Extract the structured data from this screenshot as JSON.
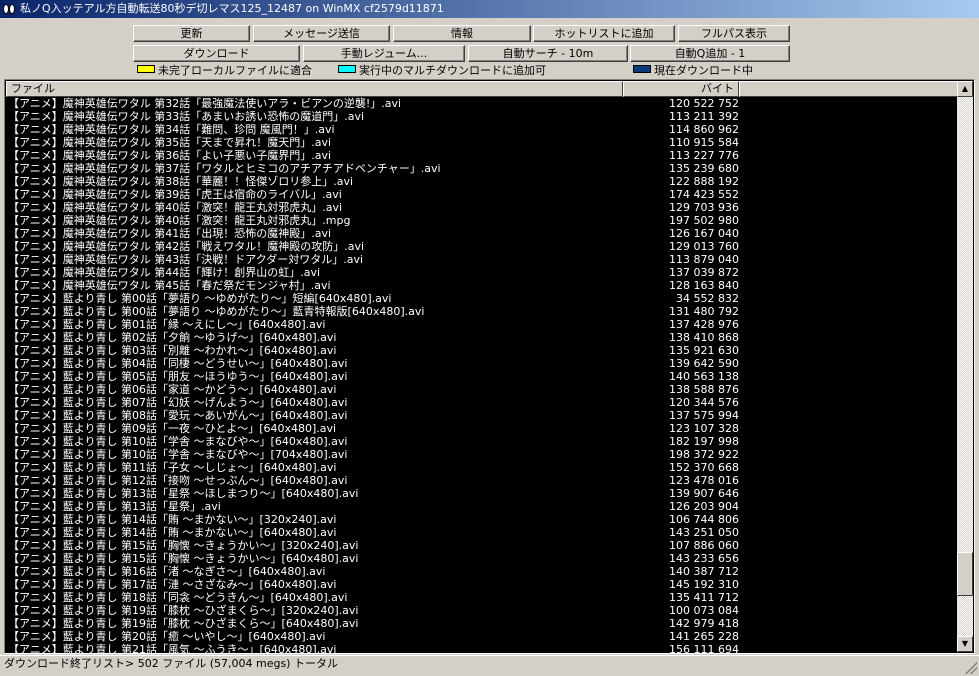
{
  "window": {
    "title": "私ノQ入ッテアル方自動転送80秒デ切レマス125_12487 on WinMX cf2579d11871"
  },
  "toolbar": {
    "row1": [
      "更新",
      "メッセージ送信",
      "情報",
      "ホットリストに追加",
      "フルパス表示"
    ],
    "row2": [
      "ダウンロード",
      "手動レジューム...",
      "自動サーチ - 10m",
      "自動Q追加 - 1"
    ]
  },
  "legend": [
    {
      "label": "未完了ローカルファイルに適合",
      "color": "#ffff00"
    },
    {
      "label": "実行中のマルチダウンロードに追加可",
      "color": "#00ffff"
    },
    {
      "label": "現在ダウンロード中",
      "color": "#0a3a7a"
    }
  ],
  "list": {
    "columns": [
      "ファイル",
      "バイト"
    ],
    "rows": [
      [
        "【アニメ】魔神英雄伝ワタル 第32話「最強魔法使いアラ・ビアンの逆襲!」.avi",
        "120 522 752"
      ],
      [
        "【アニメ】魔神英雄伝ワタル 第33話「あまいお誘い恐怖の魔道門」.avi",
        "113 211 392"
      ],
      [
        "【アニメ】魔神英雄伝ワタル 第34話「難問、珍問 魔風門！」.avi",
        "114 860 962"
      ],
      [
        "【アニメ】魔神英雄伝ワタル 第35話「天まで昇れ！魔天門」.avi",
        "110 915 584"
      ],
      [
        "【アニメ】魔神英雄伝ワタル 第36話「よい子悪い子魔界門」.avi",
        "113 227 776"
      ],
      [
        "【アニメ】魔神英雄伝ワタル 第37話「ワタルとヒミコのアチアチアドベンチャー」.avi",
        "135 239 680"
      ],
      [
        "【アニメ】魔神英雄伝ワタル 第38話「華麗！！怪傑ゾロリ参上」.avi",
        "122 888 192"
      ],
      [
        "【アニメ】魔神英雄伝ワタル 第39話「虎王は宿命のライバル」.avi",
        "174 423 552"
      ],
      [
        "【アニメ】魔神英雄伝ワタル 第40話「激突！龍王丸対邪虎丸」.avi",
        "129 703 936"
      ],
      [
        "【アニメ】魔神英雄伝ワタル 第40話「激突！龍王丸対邪虎丸」.mpg",
        "197 502 980"
      ],
      [
        "【アニメ】魔神英雄伝ワタル 第41話「出現！恐怖の魔神殿」.avi",
        "126 167 040"
      ],
      [
        "【アニメ】魔神英雄伝ワタル 第42話「戦えワタル！魔神殿の攻防」.avi",
        "129 013 760"
      ],
      [
        "【アニメ】魔神英雄伝ワタル 第43話「決戦！ドアクダー対ワタル」.avi",
        "113 879 040"
      ],
      [
        "【アニメ】魔神英雄伝ワタル 第44話「輝け！創界山の虹」.avi",
        "137 039 872"
      ],
      [
        "【アニメ】魔神英雄伝ワタル 第45話「春だ祭だモンジャ村」.avi",
        "128 163 840"
      ],
      [
        "【アニメ】藍より青し 第00話「夢語り ～ゆめがたり～」短編[640x480].avi",
        "34 552 832"
      ],
      [
        "【アニメ】藍より青し 第00話「夢語り ～ゆめがたり～」藍青特報版[640x480].avi",
        "131 480 792"
      ],
      [
        "【アニメ】藍より青し 第01話「縁 ～えにし～」[640x480].avi",
        "137 428 976"
      ],
      [
        "【アニメ】藍より青し 第02話「夕餉 ～ゆうげ～」[640x480].avi",
        "138 410 868"
      ],
      [
        "【アニメ】藍より青し 第03話「別離 ～わかれ～」[640x480].avi",
        "135 921 630"
      ],
      [
        "【アニメ】藍より青し 第04話「同棲 ～どうせい～」[640x480].avi",
        "139 642 590"
      ],
      [
        "【アニメ】藍より青し 第05話「朋友 ～ほうゆう～」[640x480].avi",
        "140 563 138"
      ],
      [
        "【アニメ】藍より青し 第06話「家道 ～かどう～」[640x480].avi",
        "138 588 876"
      ],
      [
        "【アニメ】藍より青し 第07話「幻妖 ～げんよう～」[640x480].avi",
        "120 344 576"
      ],
      [
        "【アニメ】藍より青し 第08話「愛玩 ～あいがん～」[640x480].avi",
        "137 575 994"
      ],
      [
        "【アニメ】藍より青し 第09話「一夜 ～ひとよ～」[640x480].avi",
        "123 107 328"
      ],
      [
        "【アニメ】藍より青し 第10話「学舎 ～まなびや～」[640x480].avi",
        "182 197 998"
      ],
      [
        "【アニメ】藍より青し 第10話「学舎 ～まなびや～」[704x480].avi",
        "198 372 922"
      ],
      [
        "【アニメ】藍より青し 第11話「子女 ～しじょ～」[640x480].avi",
        "152 370 668"
      ],
      [
        "【アニメ】藍より青し 第12話「接吻 ～せっぷん～」[640x480].avi",
        "123 478 016"
      ],
      [
        "【アニメ】藍より青し 第13話「星祭 ～ほしまつり～」[640x480].avi",
        "139 907 646"
      ],
      [
        "【アニメ】藍より青し 第13話「星祭」.avi",
        "126 203 904"
      ],
      [
        "【アニメ】藍より青し 第14話「賄 ～まかない～」[320x240].avi",
        "106 744 806"
      ],
      [
        "【アニメ】藍より青し 第14話「賄 ～まかない～」[640x480].avi",
        "143 251 050"
      ],
      [
        "【アニメ】藍より青し 第15話「胸懐 ～きょうかい～」[320x240].avi",
        "107 886 060"
      ],
      [
        "【アニメ】藍より青し 第15話「胸懐 ～きょうかい～」[640x480].avi",
        "143 233 656"
      ],
      [
        "【アニメ】藍より青し 第16話「渚 ～なぎさ～」[640x480].avi",
        "140 387 712"
      ],
      [
        "【アニメ】藍より青し 第17話「漣 ～さざなみ～」[640x480].avi",
        "145 192 310"
      ],
      [
        "【アニメ】藍より青し 第18話「同衾 ～どうきん～」[640x480].avi",
        "135 411 712"
      ],
      [
        "【アニメ】藍より青し 第19話「膝枕 ～ひざまくら～」[320x240].avi",
        "100 073 084"
      ],
      [
        "【アニメ】藍より青し 第19話「膝枕 ～ひざまくら～」[640x480].avi",
        "142 979 418"
      ],
      [
        "【アニメ】藍より青し 第20話「癒 ～いやし～」[640x480].avi",
        "141 265 228"
      ],
      [
        "【アニメ】藍より青し 第21話「風気 ～ふうき～」[640x480].avi",
        "156 111 694"
      ]
    ]
  },
  "scrollbar": {
    "position_fraction": 0.92
  },
  "status": {
    "text": "ダウンロード終了リスト> 502 ファイル (57,004 megs) トータル"
  },
  "icons": {
    "app": "winmx-eyes-icon",
    "scroll_up": "arrow-up-icon",
    "scroll_down": "arrow-down-icon",
    "resize": "size-grip-icon"
  }
}
